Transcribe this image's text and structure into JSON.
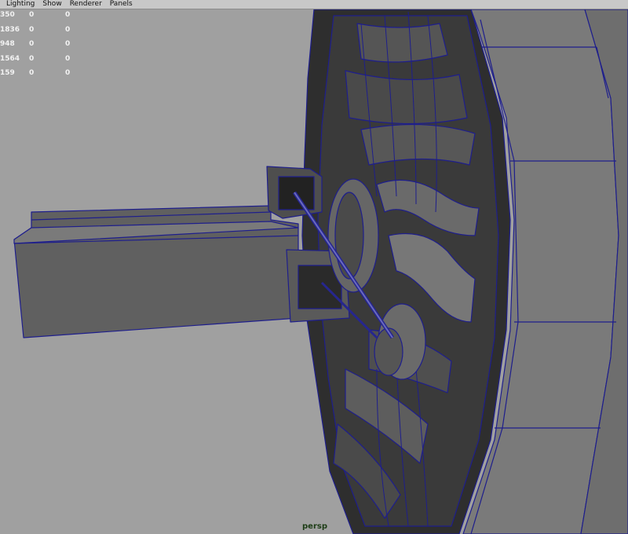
{
  "menu": {
    "items": [
      "Lighting",
      "Show",
      "Renderer",
      "Panels"
    ]
  },
  "hud": {
    "rows": [
      [
        "350",
        "0",
        "0"
      ],
      [
        "1836",
        "0",
        "0"
      ],
      [
        "948",
        "0",
        "0"
      ],
      [
        "1564",
        "0",
        "0"
      ],
      [
        "159",
        "0",
        "0"
      ]
    ]
  },
  "viewport": {
    "camera": "persp",
    "background": "#a0a0a0",
    "wire_color": "#1e1e8c",
    "shade_color": "#5a5a5a"
  }
}
